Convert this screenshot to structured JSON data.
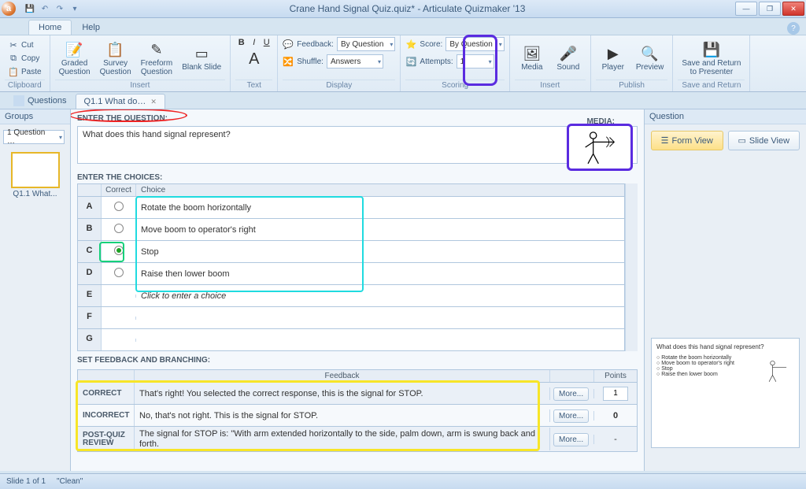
{
  "title": {
    "doc": "Crane Hand Signal Quiz.quiz*",
    "sep": " - ",
    "app": "Articulate Quizmaker '13"
  },
  "qat": {
    "save": "💾",
    "undo": "↶",
    "redo": "↷"
  },
  "win": {
    "min": "—",
    "max": "❐",
    "close": "✕"
  },
  "tabs": {
    "home": "Home",
    "help": "Help"
  },
  "ribbon": {
    "clipboard": {
      "label": "Clipboard",
      "cut": "Cut",
      "copy": "Copy",
      "paste": "Paste"
    },
    "insertq": {
      "label": "Insert",
      "graded": "Graded\nQuestion",
      "survey": "Survey\nQuestion",
      "freeform": "Freeform\nQuestion",
      "blank": "Blank Slide"
    },
    "text": {
      "label": "Text",
      "font": "Calibri",
      "size": "11"
    },
    "display": {
      "label": "Display",
      "feedback": "Feedback:",
      "feedback_val": "By Question",
      "shuffle": "Shuffle:",
      "shuffle_val": "Answers"
    },
    "scoring": {
      "label": "Scoring",
      "score": "Score:",
      "score_val": "By Question",
      "attempts": "Attempts:",
      "attempts_val": "1"
    },
    "insert2": {
      "label": "Insert",
      "media": "Media",
      "sound": "Sound"
    },
    "publish": {
      "label": "Publish",
      "player": "Player",
      "preview": "Preview"
    },
    "save": {
      "label": "Save and Return",
      "btn": "Save and Return\nto Presenter"
    }
  },
  "doctabs": {
    "questions": "Questions",
    "current": "Q1.1 What do…"
  },
  "left": {
    "groups": "Groups",
    "sel": "1 Question …",
    "thumb": "Q1.1 What..."
  },
  "question": {
    "enter_hdr": "ENTER THE QUESTION:",
    "text": "What does this hand signal represent?",
    "media_hdr": "MEDIA:",
    "choices_hdr": "ENTER THE CHOICES:",
    "col_correct": "Correct",
    "col_choice": "Choice",
    "rows": [
      "A",
      "B",
      "C",
      "D",
      "E",
      "F",
      "G"
    ],
    "choices": {
      "A": "Rotate the boom horizontally",
      "B": "Move boom to operator's right",
      "C": "Stop",
      "D": "Raise then lower boom",
      "E": "Click to enter a choice",
      "F": "",
      "G": ""
    },
    "correct_row": "C"
  },
  "feedback": {
    "hdr": "SET FEEDBACK AND BRANCHING:",
    "col_fb": "Feedback",
    "col_pts": "Points",
    "correct_l": "CORRECT",
    "correct_t": "That's right!  You selected the correct response, this is the signal for STOP.",
    "incorrect_l": "INCORRECT",
    "incorrect_t": "No, that's not right. This is the signal for STOP.",
    "post_l": "POST-QUIZ REVIEW",
    "post_t": "The signal for STOP is: \"With arm extended horizontally to the side, palm down, arm is swung back and forth.",
    "more": "More...",
    "pts_correct": "1",
    "pts_incorrect": "0",
    "pts_post": "-"
  },
  "right": {
    "hdr": "Question",
    "form": "Form View",
    "slide": "Slide View",
    "preview_q": "What does this hand signal represent?",
    "preview_a": "Rotate the boom horizontally",
    "preview_b": "Move boom to operator's right",
    "preview_c": "Stop",
    "preview_d": "Raise then lower boom"
  },
  "status": {
    "slide": "Slide 1 of 1",
    "theme": "\"Clean\""
  }
}
